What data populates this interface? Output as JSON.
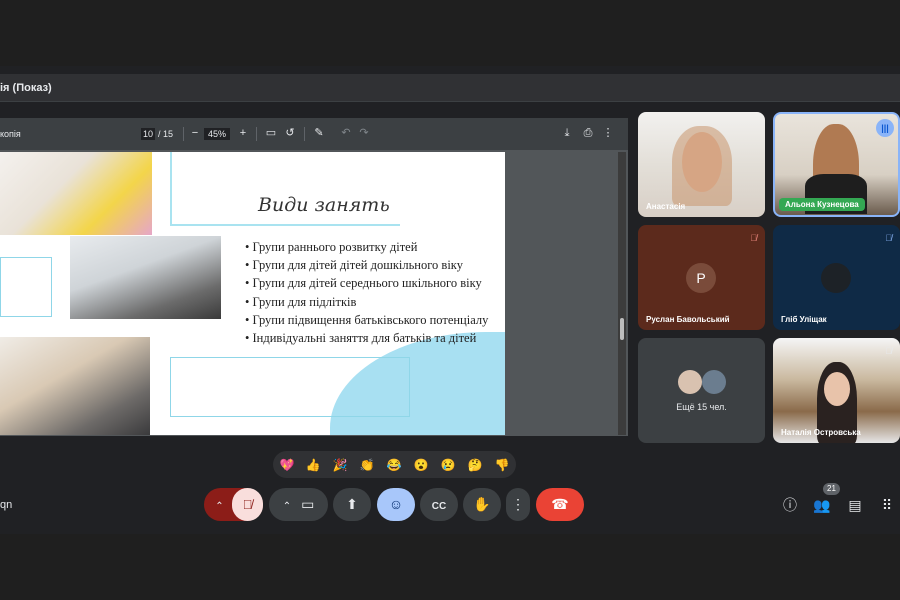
{
  "window": {
    "title": "ія (Показ)"
  },
  "pdf_viewer": {
    "file_name": "копія",
    "current_page": "10",
    "total_pages": "/ 15",
    "zoom": "45%",
    "zoom_out": "−",
    "zoom_in": "+"
  },
  "slide": {
    "title": "Види занять",
    "bullets": [
      "Групи раннього розвитку дітей",
      "Групи для дітей дітей дошкільного віку",
      "Групи для дітей середнього шкільного віку",
      "Групи для підлітків",
      "Групи підвищення батьківського потенціалу",
      "Індивідуальні заняття для батьків та дітей"
    ]
  },
  "participants": [
    {
      "name": "Анастасія"
    },
    {
      "name": "Альона Кузнецова"
    },
    {
      "name": "Руслан Бавольський",
      "initial": "P"
    },
    {
      "name": "Гліб Уліщак"
    },
    {
      "more": "Ещё 15 чел."
    },
    {
      "name": "Наталія Островська"
    }
  ],
  "reactions": [
    "💖",
    "👍",
    "🎉",
    "👏",
    "😂",
    "😮",
    "😢",
    "🤔",
    "👎"
  ],
  "meeting": {
    "code_fragment": "qn",
    "people_count": "21"
  },
  "colors": {
    "end_call": "#ea4335",
    "mic_off": "#8c1d18",
    "active_speaker": "#8ab4f8",
    "emoji_active": "#a8c7fa"
  }
}
